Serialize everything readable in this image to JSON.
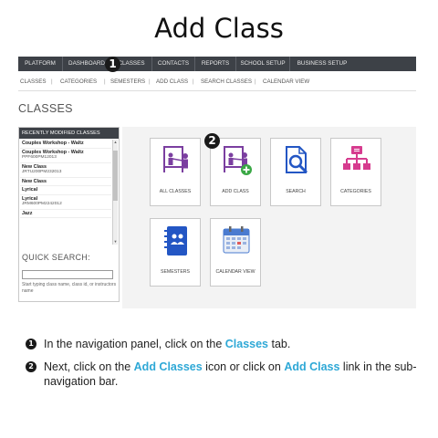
{
  "page_title": "Add Class",
  "nav": {
    "items": [
      "PLATFORM",
      "DASHBOARD",
      "CLASSES",
      "CONTACTS",
      "REPORTS",
      "SCHOOL SETUP",
      "BUSINESS SETUP"
    ],
    "badge": "1"
  },
  "subnav": {
    "items": [
      "CLASSES",
      "CATEGORIES",
      "SEMESTERS",
      "ADD CLASS",
      "SEARCH CLASSES",
      "CALENDAR VIEW"
    ],
    "separator": "|"
  },
  "heading": "CLASSES",
  "recent": {
    "header": "RECENTLY MODIFIED CLASSES",
    "items": [
      {
        "name": "Couples Workshop - Waltz",
        "id": ""
      },
      {
        "name": "Couples Workshop - Waltz",
        "id": "PPF600PM12013"
      },
      {
        "name": "New Class",
        "id": "JRTU200PM232013"
      },
      {
        "name": "New Class",
        "id": ""
      },
      {
        "name": "Lyrical",
        "id": ""
      },
      {
        "name": "Lyrical",
        "id": "JRM600PM2242012"
      },
      {
        "name": "Jazz",
        "id": ""
      }
    ]
  },
  "quick_search": {
    "label": "QUICK SEARCH:",
    "hint": "Start typing class name, class id, or instructors name"
  },
  "tiles": [
    {
      "label": "ALL CLASSES",
      "icon": "all-classes-icon"
    },
    {
      "label": "ADD CLASS",
      "icon": "add-class-icon"
    },
    {
      "label": "SEARCH",
      "icon": "search-icon"
    },
    {
      "label": "CATEGORIES",
      "icon": "categories-icon"
    },
    {
      "label": "SEMESTERS",
      "icon": "semesters-icon"
    },
    {
      "label": "CALENDAR VIEW",
      "icon": "calendar-view-icon"
    }
  ],
  "tile_badge": "2",
  "colors": {
    "purple": "#7b3fa0",
    "blue": "#2356c4",
    "pink": "#d63c8f",
    "accent": "#2ea8d6",
    "green": "#3aa845"
  },
  "steps": [
    {
      "num": "1",
      "pre": "In the navigation panel, click on the ",
      "hl1": "Classes",
      "mid": " tab.",
      "hl2": "",
      "post": ""
    },
    {
      "num": "2",
      "pre": "Next, click on the ",
      "hl1": "Add Classes",
      "mid": " icon or click on ",
      "hl2": "Add Class",
      "post": " link in the sub-navigation bar."
    }
  ]
}
